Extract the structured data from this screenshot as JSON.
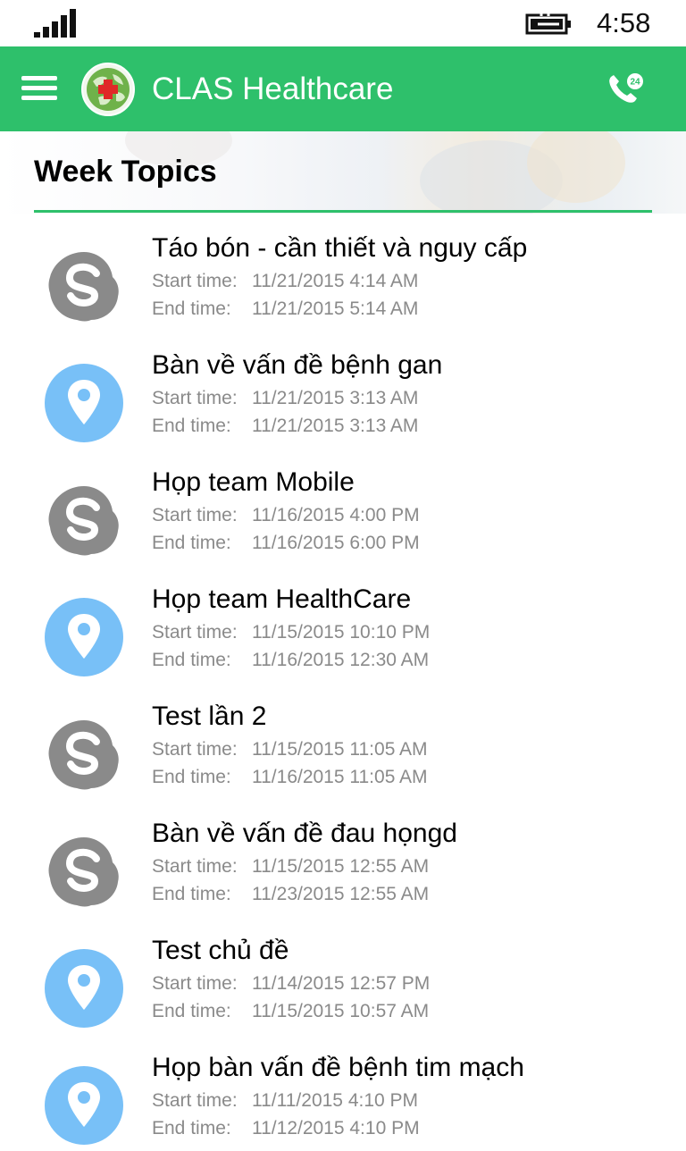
{
  "status_bar": {
    "time": "4:58",
    "signal_icon": "signal-bars-icon",
    "battery_icon": "battery-charging-icon"
  },
  "header": {
    "title": "CLAS Healthcare",
    "menu_icon": "hamburger-menu-icon",
    "logo_icon": "globe-red-cross-logo",
    "call_icon": "phone-24-icon",
    "color": "#2ec06b"
  },
  "section": {
    "title": "Week Topics"
  },
  "labels": {
    "start": "Start time:",
    "end": "End time:"
  },
  "topics": [
    {
      "title": "Táo bón - cần thiết và nguy cấp",
      "icon": "skype",
      "start": "11/21/2015 4:14 AM",
      "end": "11/21/2015 5:14 AM"
    },
    {
      "title": "Bàn về vấn đề bệnh gan",
      "icon": "location",
      "start": "11/21/2015 3:13 AM",
      "end": "11/21/2015 3:13 AM"
    },
    {
      "title": "Họp team Mobile",
      "icon": "skype",
      "start": "11/16/2015 4:00 PM",
      "end": "11/16/2015 6:00 PM"
    },
    {
      "title": "Họp team HealthCare",
      "icon": "location",
      "start": "11/15/2015 10:10 PM",
      "end": "11/16/2015 12:30 AM"
    },
    {
      "title": "Test lần 2",
      "icon": "skype",
      "start": "11/15/2015 11:05 AM",
      "end": "11/16/2015 11:05 AM"
    },
    {
      "title": "Bàn về vấn đề đau họngd",
      "icon": "skype",
      "start": "11/15/2015 12:55 AM",
      "end": "11/23/2015 12:55 AM"
    },
    {
      "title": "Test chủ đề",
      "icon": "location",
      "start": "11/14/2015 12:57 PM",
      "end": "11/15/2015 10:57 AM"
    },
    {
      "title": "Họp bàn vấn đề bệnh tim mạch",
      "icon": "location",
      "start": "11/11/2015 4:10 PM",
      "end": "11/12/2015 4:10 PM"
    }
  ]
}
